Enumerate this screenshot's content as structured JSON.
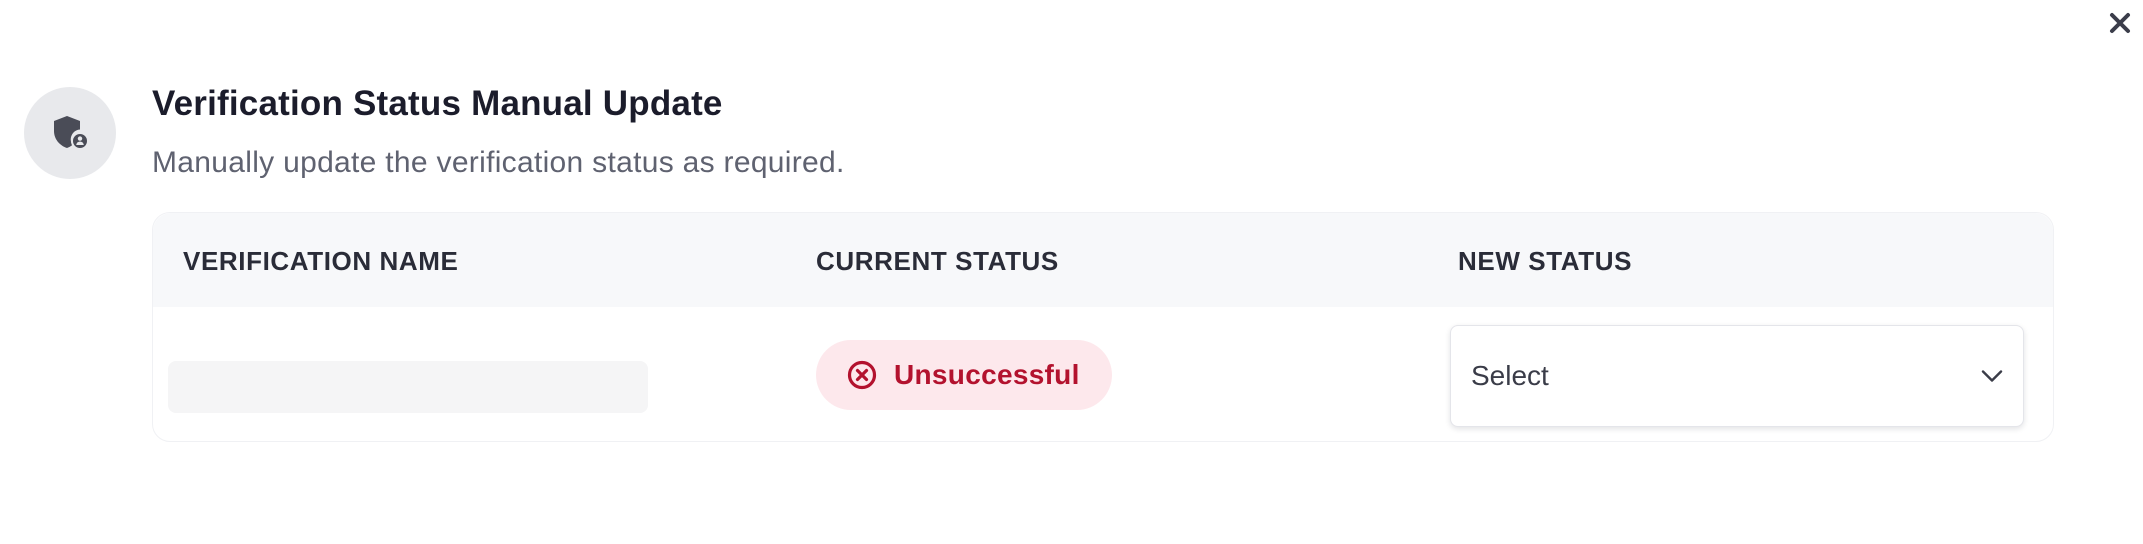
{
  "dialog": {
    "title": "Verification Status Manual Update",
    "subtitle": "Manually update the verification status as required.",
    "header_icon": "shield-user-icon",
    "close_icon": "close-icon"
  },
  "table": {
    "columns": [
      "VERIFICATION NAME",
      "CURRENT STATUS",
      "NEW STATUS"
    ],
    "rows": [
      {
        "verification_name": "",
        "current_status": {
          "label": "Unsuccessful",
          "icon": "x-circle-icon",
          "color": "#b3122e",
          "background": "#fde8ec"
        },
        "new_status": {
          "selected": "Select",
          "icon": "chevron-down-icon"
        }
      }
    ]
  }
}
